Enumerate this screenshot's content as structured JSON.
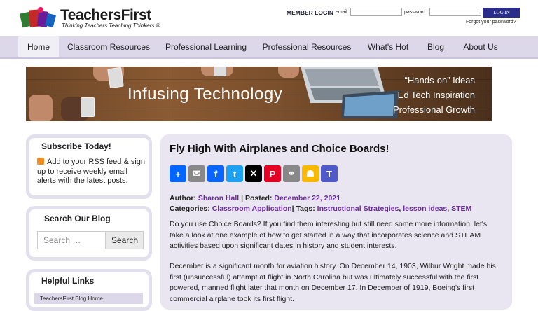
{
  "header": {
    "brand": "TeachersFirst",
    "tagline": "Thinking Teachers Teaching Thinkers ®",
    "login": {
      "title": "MEMBER LOGIN",
      "email_label": "email:",
      "password_label": "password:",
      "button": "LOG IN",
      "forgot": "Forgot your password?"
    }
  },
  "nav": {
    "items": [
      "Home",
      "Classroom Resources",
      "Professional Learning",
      "Professional Resources",
      "What's Hot",
      "Blog",
      "About Us"
    ],
    "active": "Home"
  },
  "banner": {
    "title": "Infusing Technology",
    "lines": [
      "“Hands-on” Ideas",
      "Ed Tech Inspiration",
      "Professional Growth"
    ]
  },
  "sidebar": {
    "subscribe": {
      "heading": "Subscribe Today!",
      "text": "Add to your RSS feed & sign up to receive weekly email alerts with the latest posts."
    },
    "search": {
      "heading": "Search Our Blog",
      "placeholder": "Search …",
      "button": "Search"
    },
    "links": {
      "heading": "Helpful Links",
      "items": [
        "TeachersFirst Blog Home"
      ]
    }
  },
  "post": {
    "title": "Fly High With Airplanes and Choice Boards!",
    "share_icons": [
      "share-icon",
      "email-icon",
      "facebook-icon",
      "twitter-icon",
      "x-icon",
      "pinterest-icon",
      "copy-link-icon",
      "google-classroom-icon",
      "microsoft-teams-icon"
    ],
    "share_glyphs": [
      "+",
      "✉",
      "f",
      "t",
      "✕",
      "P",
      "⚭",
      "☗",
      "T"
    ],
    "share_colors": [
      "#0166ff",
      "#888888",
      "#0866ff",
      "#1da1f2",
      "#000000",
      "#e60023",
      "#888888",
      "#f8b900",
      "#5059c9"
    ],
    "author_label": "Author:",
    "author": "Sharon Hall",
    "posted_label": "| Posted:",
    "date": "December 22, 2021",
    "categories_label": "Categories:",
    "category": "Classroom Application",
    "tags_label": "| Tags:",
    "tags": [
      "Instructional Strategies",
      "lesson ideas",
      "STEM"
    ],
    "para1": "Do you use Choice Boards? If you find them interesting but still need some more information, let's take a look at one example of how to get started in a way that incorporates science and STEAM activities based upon significant dates in history and student interests.",
    "para2": "December is a significant month for aviation history. On December 14, 1903, Wilbur Wright made his first (unsuccessful) attempt at flight in North Carolina but was ultimately successful with the first powered, manned flight later that month on December 17. In December of 1919, Boeing's first commercial airplane took its first flight."
  }
}
